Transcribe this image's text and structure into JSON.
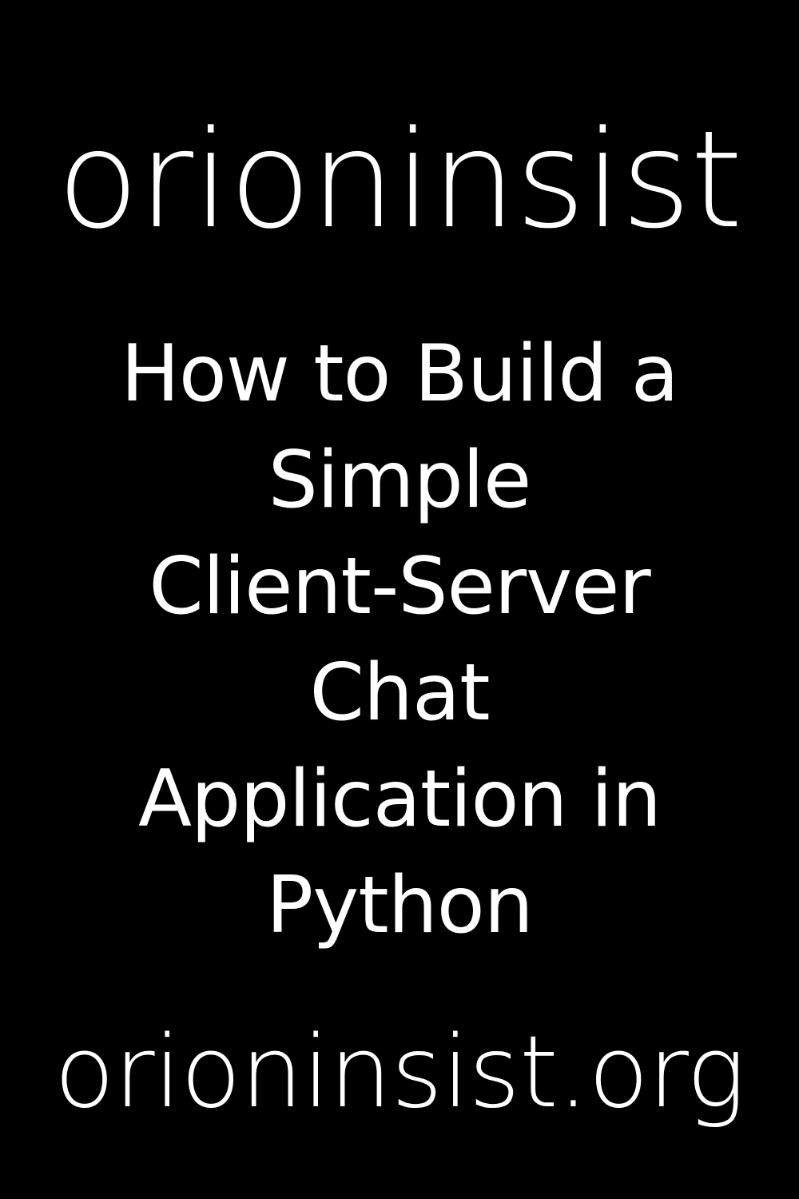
{
  "brand": "orioninsist",
  "headline": {
    "lines": [
      "How to Build a",
      "Simple",
      "Client-Server",
      "Chat",
      "Application in",
      "Python"
    ]
  },
  "footer": {
    "domain": "orioninsist.org"
  },
  "colors": {
    "background": "#000000",
    "text": "#ffffff"
  }
}
